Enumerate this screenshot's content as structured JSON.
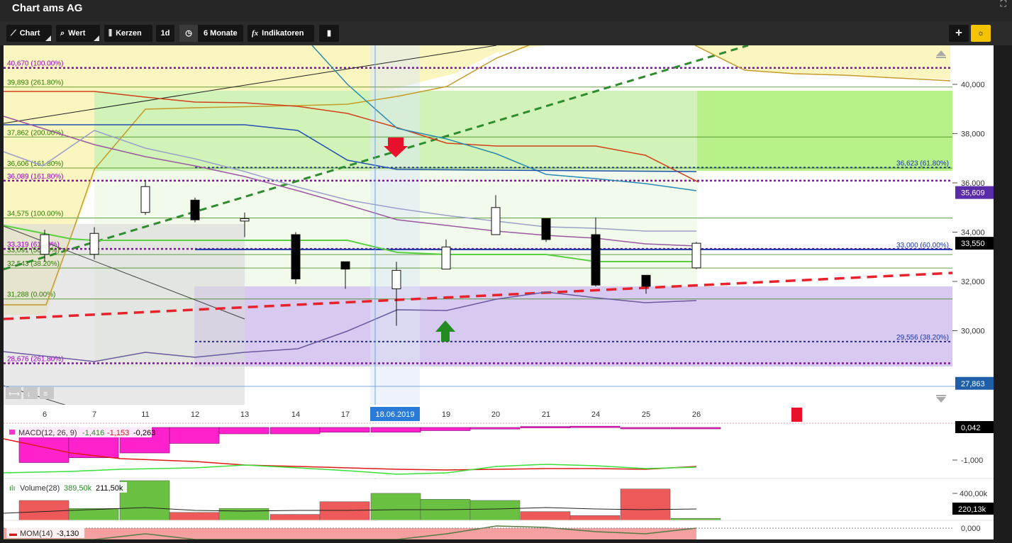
{
  "window": {
    "title": "Chart ams AG"
  },
  "toolbar": {
    "chart_label": "Chart",
    "value_label": "Wert",
    "candles_label": "Kerzen",
    "interval_label": "1d",
    "period_label": "6 Monate",
    "indicators_label": "Indikatoren"
  },
  "chart_data": {
    "type": "candlestick",
    "title": "Chart ams AG",
    "x_labels": [
      "6",
      "7",
      "11",
      "12",
      "13",
      "14",
      "17",
      "18.06.2019",
      "19",
      "20",
      "21",
      "24",
      "25",
      "26"
    ],
    "highlight_x": "18.06.2019",
    "price_axis": {
      "ticks": [
        "40,000",
        "38,000",
        "36,000",
        "34,000",
        "32,000",
        "30,000"
      ],
      "range": [
        27.5,
        41.5
      ]
    },
    "candles": [
      {
        "date": "6",
        "open": 33.1,
        "high": 34.1,
        "low": 32.8,
        "close": 33.9
      },
      {
        "date": "7",
        "open": 33.1,
        "high": 34.2,
        "low": 32.9,
        "close": 33.95
      },
      {
        "date": "11",
        "open": 34.8,
        "high": 36.1,
        "low": 34.7,
        "close": 35.85
      },
      {
        "date": "12",
        "open": 35.3,
        "high": 35.4,
        "low": 34.4,
        "close": 34.5
      },
      {
        "date": "13",
        "open": 34.45,
        "high": 34.8,
        "low": 33.8,
        "close": 34.55
      },
      {
        "date": "14",
        "open": 33.9,
        "high": 34.0,
        "low": 31.9,
        "close": 32.1
      },
      {
        "date": "17",
        "open": 32.8,
        "high": 32.8,
        "low": 31.7,
        "close": 32.5
      },
      {
        "date": "18.06.2019",
        "open": 31.7,
        "high": 32.8,
        "low": 30.2,
        "close": 32.45
      },
      {
        "date": "19",
        "open": 32.5,
        "high": 33.7,
        "low": 32.5,
        "close": 33.4
      },
      {
        "date": "20",
        "open": 33.9,
        "high": 35.5,
        "low": 33.9,
        "close": 35.0
      },
      {
        "date": "21",
        "open": 34.55,
        "high": 34.55,
        "low": 33.6,
        "close": 33.7
      },
      {
        "date": "24",
        "open": 33.9,
        "high": 34.6,
        "low": 31.8,
        "close": 31.85
      },
      {
        "date": "25",
        "open": 32.25,
        "high": 32.25,
        "low": 31.5,
        "close": 31.8
      },
      {
        "date": "26",
        "open": 32.55,
        "high": 33.6,
        "low": 32.5,
        "close": 33.55
      }
    ],
    "left_levels": [
      {
        "label": "40,670 (100.00%)",
        "value": 40.67,
        "color": "#9b00c8"
      },
      {
        "label": "39,893 (261.80%)",
        "value": 39.893,
        "color": "#2b7a00"
      },
      {
        "label": "37,862 (200.00%)",
        "value": 37.862,
        "color": "#2b7a00"
      },
      {
        "label": "36,606 (161.80%)",
        "value": 36.606,
        "color": "#2b7a00"
      },
      {
        "label": "36,089 (161.80%)",
        "value": 36.089,
        "color": "#9b00c8"
      },
      {
        "label": "34,575 (100.00%)",
        "value": 34.575,
        "color": "#2b7a00"
      },
      {
        "label": "33,319 (61.80%)",
        "value": 33.319,
        "color": "#9b00c8"
      },
      {
        "label": "33,091 (50.00%)",
        "value": 33.091,
        "color": "#2b7a00"
      },
      {
        "label": "32,543 (38.20%)",
        "value": 32.543,
        "color": "#2b7a00"
      },
      {
        "label": "31,288 (0.00%)",
        "value": 31.288,
        "color": "#2b7a00"
      },
      {
        "label": "28,676 (261.80%)",
        "value": 28.676,
        "color": "#9b00c8"
      }
    ],
    "right_levels": [
      {
        "label": "36,623 (61.80%)",
        "value": 36.623,
        "color": "#1a35a8"
      },
      {
        "label": "33,000 (60.00%)",
        "value": 33.3,
        "color": "#1a35a8"
      },
      {
        "label": "29,556 (38.20%)",
        "value": 29.556,
        "color": "#1a35a8"
      }
    ],
    "price_badges": [
      {
        "label": "35,609",
        "value": 35.609,
        "color": "#5b2ca8"
      },
      {
        "label": "33,550",
        "value": 33.55,
        "color": "#000000"
      },
      {
        "label": "27,863",
        "value": 27.863,
        "color": "#1e5fa8"
      }
    ],
    "macd": {
      "label": "MACD(12, 26, 9)",
      "v1": "-1,416",
      "v2": "-1,153",
      "v3": "-0,263",
      "axis_ticks": [
        "-1,000"
      ],
      "badge": "0,042",
      "hist": [
        -1.1,
        -0.95,
        -0.8,
        -0.5,
        -0.2,
        -0.2,
        -0.15,
        -0.15,
        -0.1,
        -0.05,
        0.03,
        0.04,
        -0.03,
        -0.03
      ]
    },
    "volume": {
      "label": "Volume(28)",
      "v1": "389,50k",
      "v2": "211,50k",
      "axis_ticks": [
        "400,00k"
      ],
      "badge": "220,13k",
      "bars": [
        {
          "v": 0.5,
          "up": false
        },
        {
          "v": 0.3,
          "up": true
        },
        {
          "v": 1.0,
          "up": true
        },
        {
          "v": 0.2,
          "up": false
        },
        {
          "v": 0.3,
          "up": true
        },
        {
          "v": 0.15,
          "up": false
        },
        {
          "v": 0.47,
          "up": false
        },
        {
          "v": 0.68,
          "up": true
        },
        {
          "v": 0.53,
          "up": true
        },
        {
          "v": 0.5,
          "up": true
        },
        {
          "v": 0.22,
          "up": false
        },
        {
          "v": 0.12,
          "up": false
        },
        {
          "v": 0.79,
          "up": false
        },
        {
          "v": 0.05,
          "up": true
        }
      ]
    },
    "momentum": {
      "label": "MOM(14)",
      "v1": "-3,130",
      "axis_ticks": [
        "0,000"
      ]
    }
  }
}
